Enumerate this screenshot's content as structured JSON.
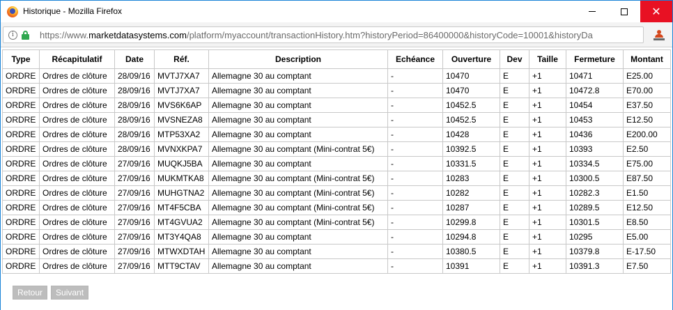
{
  "window": {
    "title": "Historique - Mozilla Firefox"
  },
  "urlbar": {
    "scheme": "https://www.",
    "host": "marketdatasystems.com",
    "path": "/platform/myaccount/transactionHistory.htm?historyPeriod=86400000&historyCode=10001&historyDa"
  },
  "table": {
    "headers": [
      "Type",
      "Récapitulatif",
      "Date",
      "Réf.",
      "Description",
      "Echéance",
      "Ouverture",
      "Dev",
      "Taille",
      "Fermeture",
      "Montant"
    ],
    "rows": [
      [
        "ORDRE",
        "Ordres de clôture",
        "28/09/16",
        "MVTJ7XA7",
        "Allemagne 30 au comptant",
        "-",
        "10470",
        "E",
        "+1",
        "10471",
        "E25.00"
      ],
      [
        "ORDRE",
        "Ordres de clôture",
        "28/09/16",
        "MVTJ7XA7",
        "Allemagne 30 au comptant",
        "-",
        "10470",
        "E",
        "+1",
        "10472.8",
        "E70.00"
      ],
      [
        "ORDRE",
        "Ordres de clôture",
        "28/09/16",
        "MVS6K6AP",
        "Allemagne 30 au comptant",
        "-",
        "10452.5",
        "E",
        "+1",
        "10454",
        "E37.50"
      ],
      [
        "ORDRE",
        "Ordres de clôture",
        "28/09/16",
        "MVSNEZA8",
        "Allemagne 30 au comptant",
        "-",
        "10452.5",
        "E",
        "+1",
        "10453",
        "E12.50"
      ],
      [
        "ORDRE",
        "Ordres de clôture",
        "28/09/16",
        "MTP53XA2",
        "Allemagne 30 au comptant",
        "-",
        "10428",
        "E",
        "+1",
        "10436",
        "E200.00"
      ],
      [
        "ORDRE",
        "Ordres de clôture",
        "28/09/16",
        "MVNXKPA7",
        "Allemagne 30 au comptant (Mini-contrat 5€)",
        "-",
        "10392.5",
        "E",
        "+1",
        "10393",
        "E2.50"
      ],
      [
        "ORDRE",
        "Ordres de clôture",
        "27/09/16",
        "MUQKJ5BA",
        "Allemagne 30 au comptant",
        "-",
        "10331.5",
        "E",
        "+1",
        "10334.5",
        "E75.00"
      ],
      [
        "ORDRE",
        "Ordres de clôture",
        "27/09/16",
        "MUKMTKA8",
        "Allemagne 30 au comptant (Mini-contrat 5€)",
        "-",
        "10283",
        "E",
        "+1",
        "10300.5",
        "E87.50"
      ],
      [
        "ORDRE",
        "Ordres de clôture",
        "27/09/16",
        "MUHGTNA2",
        "Allemagne 30 au comptant (Mini-contrat 5€)",
        "-",
        "10282",
        "E",
        "+1",
        "10282.3",
        "E1.50"
      ],
      [
        "ORDRE",
        "Ordres de clôture",
        "27/09/16",
        "MT4F5CBA",
        "Allemagne 30 au comptant (Mini-contrat 5€)",
        "-",
        "10287",
        "E",
        "+1",
        "10289.5",
        "E12.50"
      ],
      [
        "ORDRE",
        "Ordres de clôture",
        "27/09/16",
        "MT4GVUA2",
        "Allemagne 30 au comptant (Mini-contrat 5€)",
        "-",
        "10299.8",
        "E",
        "+1",
        "10301.5",
        "E8.50"
      ],
      [
        "ORDRE",
        "Ordres de clôture",
        "27/09/16",
        "MT3Y4QA8",
        "Allemagne 30 au comptant",
        "-",
        "10294.8",
        "E",
        "+1",
        "10295",
        "E5.00"
      ],
      [
        "ORDRE",
        "Ordres de clôture",
        "27/09/16",
        "MTWXDTAH",
        "Allemagne 30 au comptant",
        "-",
        "10380.5",
        "E",
        "+1",
        "10379.8",
        "E-17.50"
      ],
      [
        "ORDRE",
        "Ordres de clôture",
        "27/09/16",
        "MTT9CTAV",
        "Allemagne 30 au comptant",
        "-",
        "10391",
        "E",
        "+1",
        "10391.3",
        "E7.50"
      ]
    ]
  },
  "pager": {
    "prev_label": "Retour",
    "next_label": "Suivant"
  },
  "colors": {
    "window_border": "#1883d7",
    "close_button": "#e81123",
    "lock": "#2fa84f",
    "pager_button": "#bdbdbd"
  }
}
